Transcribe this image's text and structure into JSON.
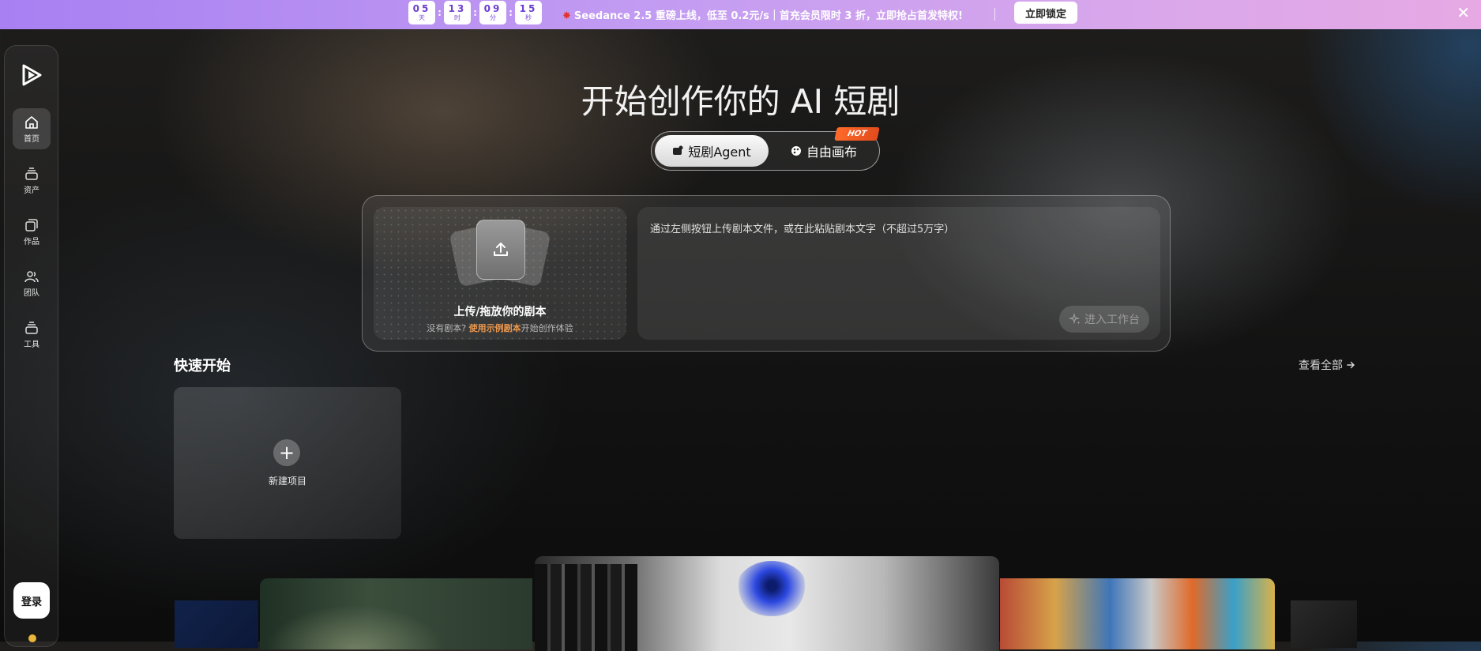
{
  "banner": {
    "countdown": [
      {
        "value": "05",
        "unit": "天"
      },
      {
        "value": "13",
        "unit": "时"
      },
      {
        "value": "09",
        "unit": "分"
      },
      {
        "value": "15",
        "unit": "秒"
      }
    ],
    "promo_text": "Seedance 2.5 重磅上线，低至 0.2元/s｜首充会员限时 3 折，立即抢占首发特权!",
    "cta_label": "立即锁定",
    "close_glyph": "✕"
  },
  "sidebar": {
    "items": [
      {
        "label": "首页",
        "icon": "home-icon",
        "active": true
      },
      {
        "label": "资产",
        "icon": "assets-icon",
        "active": false
      },
      {
        "label": "作品",
        "icon": "works-icon",
        "active": false
      },
      {
        "label": "团队",
        "icon": "team-icon",
        "active": false
      },
      {
        "label": "工具",
        "icon": "tools-icon",
        "active": false
      }
    ],
    "login_label": "登录"
  },
  "hero": {
    "title": "开始创作你的 AI 短剧",
    "tabs": [
      {
        "label": "短剧Agent",
        "active": true
      },
      {
        "label": "自由画布",
        "active": false
      }
    ],
    "hot_badge": "HOT"
  },
  "upload": {
    "title": "上传/拖放你的剧本",
    "sub_prefix": "没有剧本?",
    "sub_link": "使用示例剧本",
    "sub_suffix": "开始创作体验",
    "placeholder": "通过左侧按钮上传剧本文件，或在此粘贴剧本文字（不超过5万字）",
    "enter_label": "进入工作台"
  },
  "quick_start": {
    "title": "快速开始",
    "view_all": "查看全部",
    "new_project": "新建项目"
  },
  "colors": {
    "accent_orange": "#f09a4e",
    "banner_purple": "#a880f2",
    "hot_badge": "#ff6a2b"
  }
}
